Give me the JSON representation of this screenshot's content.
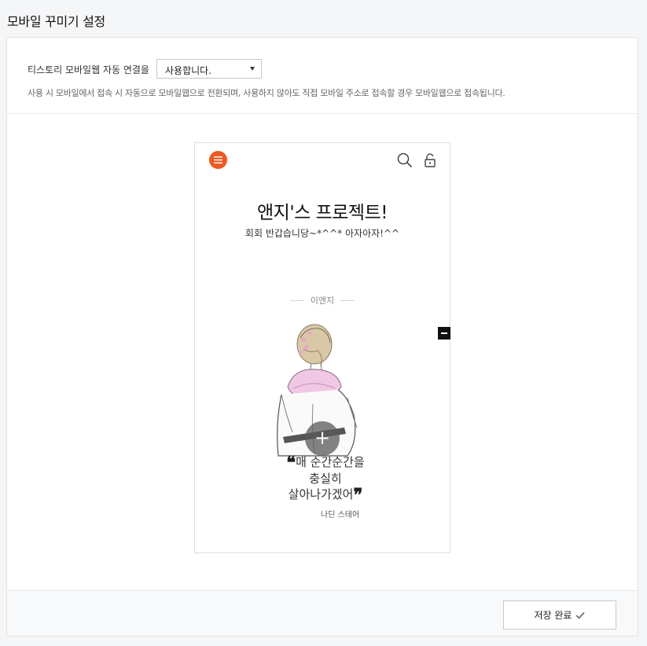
{
  "page": {
    "title": "모바일 꾸미기 설정"
  },
  "settings": {
    "auto_connect_label": "티스토리 모바일웹 자동 연결을",
    "auto_connect_value": "사용합니다.",
    "description": "사용 시 모바일에서 접속 시 자동으로 모바일웹으로 전환되며, 사용하지 않아도 직접 모바일 주소로 접속할 경우 모바일웹으로 접속됩니다."
  },
  "preview": {
    "blog_title": "앤지'스 프로젝트!",
    "blog_subtitle": "회회 반갑습니당~*^^* 아자아자!^^",
    "profile_name": "이앤지",
    "quote_line1": "매 순간순간을",
    "quote_line2": "충실히",
    "quote_line3": "살아나가겠어",
    "quote_author": "나딘 스테어",
    "icons": [
      "menu-icon",
      "search-icon",
      "lock-icon",
      "minus-icon",
      "plus-icon"
    ],
    "accent_color": "#ed5a24"
  },
  "footer": {
    "save_label": "저장 완료"
  }
}
